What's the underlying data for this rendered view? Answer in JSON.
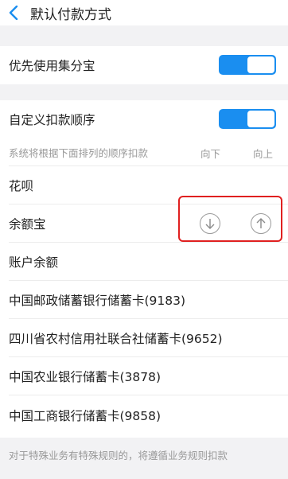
{
  "header": {
    "title": "默认付款方式",
    "back_icon": "chevron-left-icon"
  },
  "priority": {
    "label": "优先使用集分宝",
    "enabled": true
  },
  "custom_order": {
    "label": "自定义扣款顺序",
    "enabled": true,
    "hint": "系统将根据下面排列的顺序扣款",
    "col_down": "向下",
    "col_up": "向上"
  },
  "payment_methods": [
    {
      "label": "花呗"
    },
    {
      "label": "余额宝"
    },
    {
      "label": "账户余额"
    },
    {
      "label": "中国邮政储蓄银行储蓄卡(9183)"
    },
    {
      "label": "四川省农村信用社联合社储蓄卡(9652)"
    },
    {
      "label": "中国农业银行储蓄卡(3878)"
    },
    {
      "label": "中国工商银行储蓄卡(9858)"
    }
  ],
  "footer_note": "对于特殊业务有特殊规则的，将遵循业务规则扣款",
  "colors": {
    "accent": "#1a8ef0",
    "highlight": "#e02020"
  }
}
